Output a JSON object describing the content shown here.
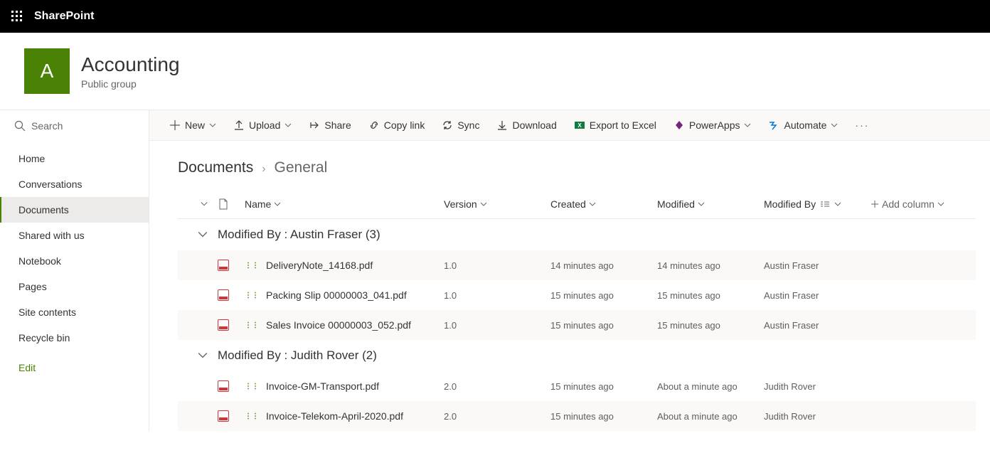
{
  "brand": "SharePoint",
  "site": {
    "logo_letter": "A",
    "title": "Accounting",
    "subtitle": "Public group"
  },
  "search": {
    "placeholder": "Search"
  },
  "nav": {
    "items": [
      {
        "label": "Home",
        "active": false
      },
      {
        "label": "Conversations",
        "active": false
      },
      {
        "label": "Documents",
        "active": true
      },
      {
        "label": "Shared with us",
        "active": false
      },
      {
        "label": "Notebook",
        "active": false
      },
      {
        "label": "Pages",
        "active": false
      },
      {
        "label": "Site contents",
        "active": false
      },
      {
        "label": "Recycle bin",
        "active": false
      }
    ],
    "edit_label": "Edit"
  },
  "toolbar": {
    "new": "New",
    "upload": "Upload",
    "share": "Share",
    "copylink": "Copy link",
    "sync": "Sync",
    "download": "Download",
    "export": "Export to Excel",
    "powerapps": "PowerApps",
    "automate": "Automate"
  },
  "breadcrumb": {
    "root": "Documents",
    "leaf": "General"
  },
  "columns": {
    "name": "Name",
    "version": "Version",
    "created": "Created",
    "modified": "Modified",
    "modified_by": "Modified By",
    "add_column": "Add column"
  },
  "groups": [
    {
      "label": "Modified By : Austin Fraser (3)",
      "rows": [
        {
          "name": "DeliveryNote_14168.pdf",
          "version": "1.0",
          "created": "14 minutes ago",
          "modified": "14 minutes ago",
          "by": "Austin Fraser"
        },
        {
          "name": "Packing Slip 00000003_041.pdf",
          "version": "1.0",
          "created": "15 minutes ago",
          "modified": "15 minutes ago",
          "by": "Austin Fraser"
        },
        {
          "name": "Sales Invoice 00000003_052.pdf",
          "version": "1.0",
          "created": "15 minutes ago",
          "modified": "15 minutes ago",
          "by": "Austin Fraser"
        }
      ]
    },
    {
      "label": "Modified By : Judith Rover (2)",
      "rows": [
        {
          "name": "Invoice-GM-Transport.pdf",
          "version": "2.0",
          "created": "15 minutes ago",
          "modified": "About a minute ago",
          "by": "Judith Rover"
        },
        {
          "name": "Invoice-Telekom-April-2020.pdf",
          "version": "2.0",
          "created": "15 minutes ago",
          "modified": "About a minute ago",
          "by": "Judith Rover"
        }
      ]
    }
  ]
}
